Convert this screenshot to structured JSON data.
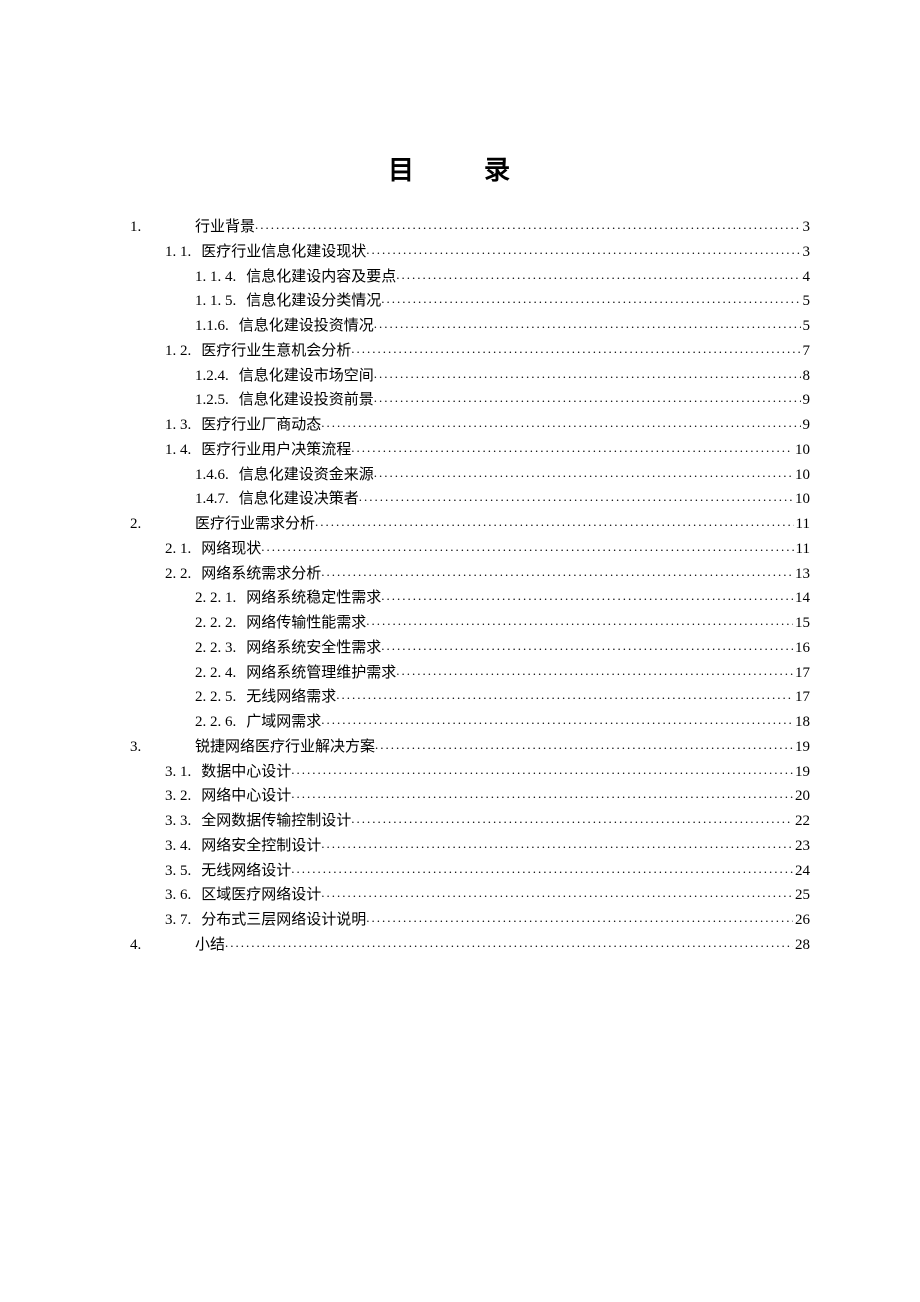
{
  "title": "目　录",
  "toc": [
    {
      "level": 1,
      "num": "1.",
      "heading": "行业背景",
      "page": "3"
    },
    {
      "level": 2,
      "num": "1. 1.",
      "heading": "医疗行业信息化建设现状",
      "page": "3"
    },
    {
      "level": 3,
      "num": "1. 1. 4.",
      "heading": "信息化建设内容及要点",
      "page": "4"
    },
    {
      "level": 3,
      "num": "1. 1. 5.",
      "heading": "信息化建设分类情况",
      "page": "5"
    },
    {
      "level": 3,
      "num": "1.1.6.",
      "heading": "信息化建设投资情况",
      "page": "5"
    },
    {
      "level": 2,
      "num": "1. 2.",
      "heading": "医疗行业生意机会分析",
      "page": "7"
    },
    {
      "level": 3,
      "num": "1.2.4.",
      "heading": "信息化建设市场空间",
      "page": "8"
    },
    {
      "level": 3,
      "num": "1.2.5.",
      "heading": "信息化建设投资前景",
      "page": "9"
    },
    {
      "level": 2,
      "num": "1. 3.",
      "heading": "医疗行业厂商动态",
      "page": "9"
    },
    {
      "level": 2,
      "num": "1. 4.",
      "heading": "医疗行业用户决策流程",
      "page": "10"
    },
    {
      "level": 3,
      "num": "1.4.6.",
      "heading": "信息化建设资金来源",
      "page": "10"
    },
    {
      "level": 3,
      "num": "1.4.7.",
      "heading": "信息化建设决策者",
      "page": "10"
    },
    {
      "level": 1,
      "num": "2.",
      "heading": "医疗行业需求分析",
      "page": "11"
    },
    {
      "level": 2,
      "num": "2. 1.",
      "heading": "网络现状",
      "page": "11"
    },
    {
      "level": 2,
      "num": "2. 2.",
      "heading": "网络系统需求分析",
      "page": "13"
    },
    {
      "level": 3,
      "num": "2. 2. 1.",
      "heading": "网络系统稳定性需求",
      "page": "14"
    },
    {
      "level": 3,
      "num": "2. 2. 2.",
      "heading": "网络传输性能需求",
      "page": "15"
    },
    {
      "level": 3,
      "num": "2. 2. 3.",
      "heading": "网络系统安全性需求",
      "page": "16"
    },
    {
      "level": 3,
      "num": "2. 2. 4.",
      "heading": "网络系统管理维护需求",
      "page": "17"
    },
    {
      "level": 3,
      "num": "2. 2. 5.",
      "heading": "无线网络需求",
      "page": "17"
    },
    {
      "level": 3,
      "num": "2. 2. 6.",
      "heading": "广域网需求",
      "page": "18"
    },
    {
      "level": 1,
      "num": "3.",
      "heading": "锐捷网络医疗行业解决方案",
      "page": "19"
    },
    {
      "level": 2,
      "num": "3. 1.",
      "heading": "数据中心设计",
      "page": "19"
    },
    {
      "level": 2,
      "num": "3. 2.",
      "heading": "网络中心设计",
      "page": "20"
    },
    {
      "level": 2,
      "num": "3. 3.",
      "heading": "全网数据传输控制设计",
      "page": "22"
    },
    {
      "level": 2,
      "num": "3. 4.",
      "heading": "网络安全控制设计",
      "page": "23"
    },
    {
      "level": 2,
      "num": "3. 5.",
      "heading": "无线网络设计",
      "page": "24"
    },
    {
      "level": 2,
      "num": "3. 6.",
      "heading": "区域医疗网络设计",
      "page": "25"
    },
    {
      "level": 2,
      "num": "3. 7.",
      "heading": "分布式三层网络设计说明",
      "page": "26"
    },
    {
      "level": 1,
      "num": "4.",
      "heading": "小结",
      "page": "28"
    }
  ]
}
